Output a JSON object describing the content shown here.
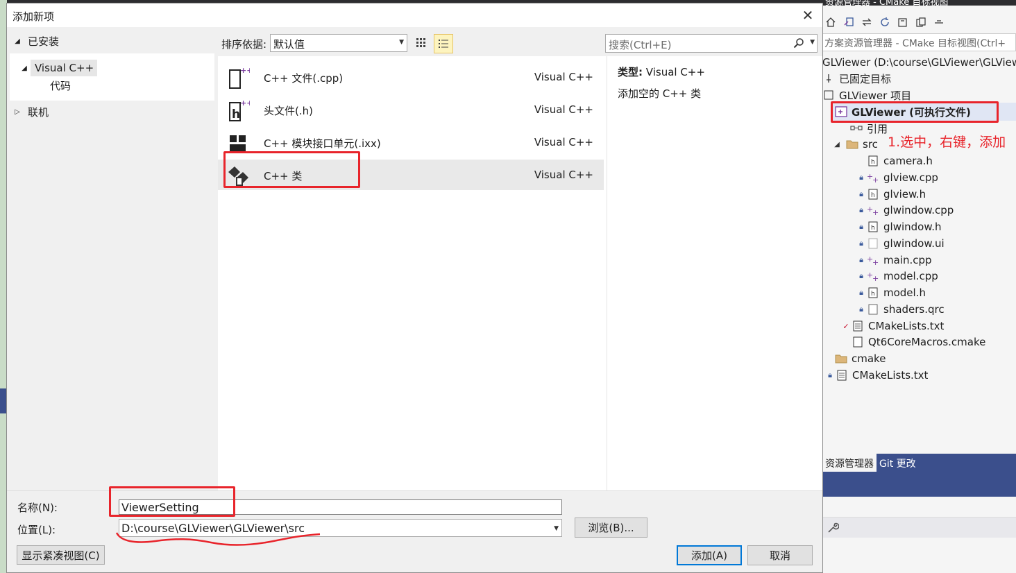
{
  "background": {
    "solution_explorer": {
      "title": "资源管理器 - CMake 目标视图",
      "search_placeholder": "方案资源管理器 - CMake 目标视图(Ctrl+",
      "tree": [
        {
          "label": "GLViewer (D:\\course\\GLViewer\\GLViewer)",
          "icon": "root-icon"
        },
        {
          "label": "已固定目标",
          "icon": "pin-icon"
        },
        {
          "label": "GLViewer 项目",
          "icon": "project-icon"
        },
        {
          "label": "GLViewer (可执行文件)",
          "icon": "executable-icon"
        },
        {
          "label": "引用",
          "icon": "reference-icon"
        },
        {
          "label": "src",
          "icon": "folder-icon"
        },
        {
          "label": "camera.h",
          "icon": "header-file-icon"
        },
        {
          "label": "glview.cpp",
          "icon": "cpp-file-icon"
        },
        {
          "label": "glview.h",
          "icon": "header-file-icon"
        },
        {
          "label": "glwindow.cpp",
          "icon": "cpp-file-icon"
        },
        {
          "label": "glwindow.h",
          "icon": "header-file-icon"
        },
        {
          "label": "glwindow.ui",
          "icon": "ui-file-icon"
        },
        {
          "label": "main.cpp",
          "icon": "cpp-file-icon"
        },
        {
          "label": "model.cpp",
          "icon": "cpp-file-icon"
        },
        {
          "label": "model.h",
          "icon": "header-file-icon"
        },
        {
          "label": "shaders.qrc",
          "icon": "file-icon"
        },
        {
          "label": "CMakeLists.txt",
          "icon": "text-file-icon"
        },
        {
          "label": "Qt6CoreMacros.cmake",
          "icon": "file-icon"
        },
        {
          "label": "cmake",
          "icon": "folder-icon"
        },
        {
          "label": "CMakeLists.txt",
          "icon": "text-file-icon"
        }
      ],
      "tabs": [
        "资源管理器",
        "Git 更改"
      ]
    }
  },
  "dialog": {
    "title": "添加新项",
    "close_label": "✕",
    "categories": {
      "installed": "已安装",
      "visual_cpp": "Visual C++",
      "code": "代码",
      "online": "联机"
    },
    "sort_label": "排序依据:",
    "sort_value": "默认值",
    "search_placeholder": "搜索(Ctrl+E)",
    "templates": [
      {
        "name": "C++ 文件(.cpp)",
        "lang": "Visual C++",
        "icon": "cpp-file-template-icon"
      },
      {
        "name": "头文件(.h)",
        "lang": "Visual C++",
        "icon": "header-file-template-icon"
      },
      {
        "name": "C++ 模块接口单元(.ixx)",
        "lang": "Visual C++",
        "icon": "module-template-icon"
      },
      {
        "name": "C++ 类",
        "lang": "Visual C++",
        "icon": "class-template-icon"
      }
    ],
    "description": {
      "type_label": "类型:",
      "type_value": "Visual C++",
      "text": "添加空的 C++ 类"
    },
    "name_label": "名称(N):",
    "name_value": "ViewerSetting",
    "location_label": "位置(L):",
    "location_value": "D:\\course\\GLViewer\\GLViewer\\src",
    "browse_button": "浏览(B)...",
    "compact_view_button": "显示紧凑视图(C)",
    "add_button": "添加(A)",
    "cancel_button": "取消"
  },
  "annotation": {
    "text": "1.选中，右键，添加",
    "color": "#e8242b"
  }
}
